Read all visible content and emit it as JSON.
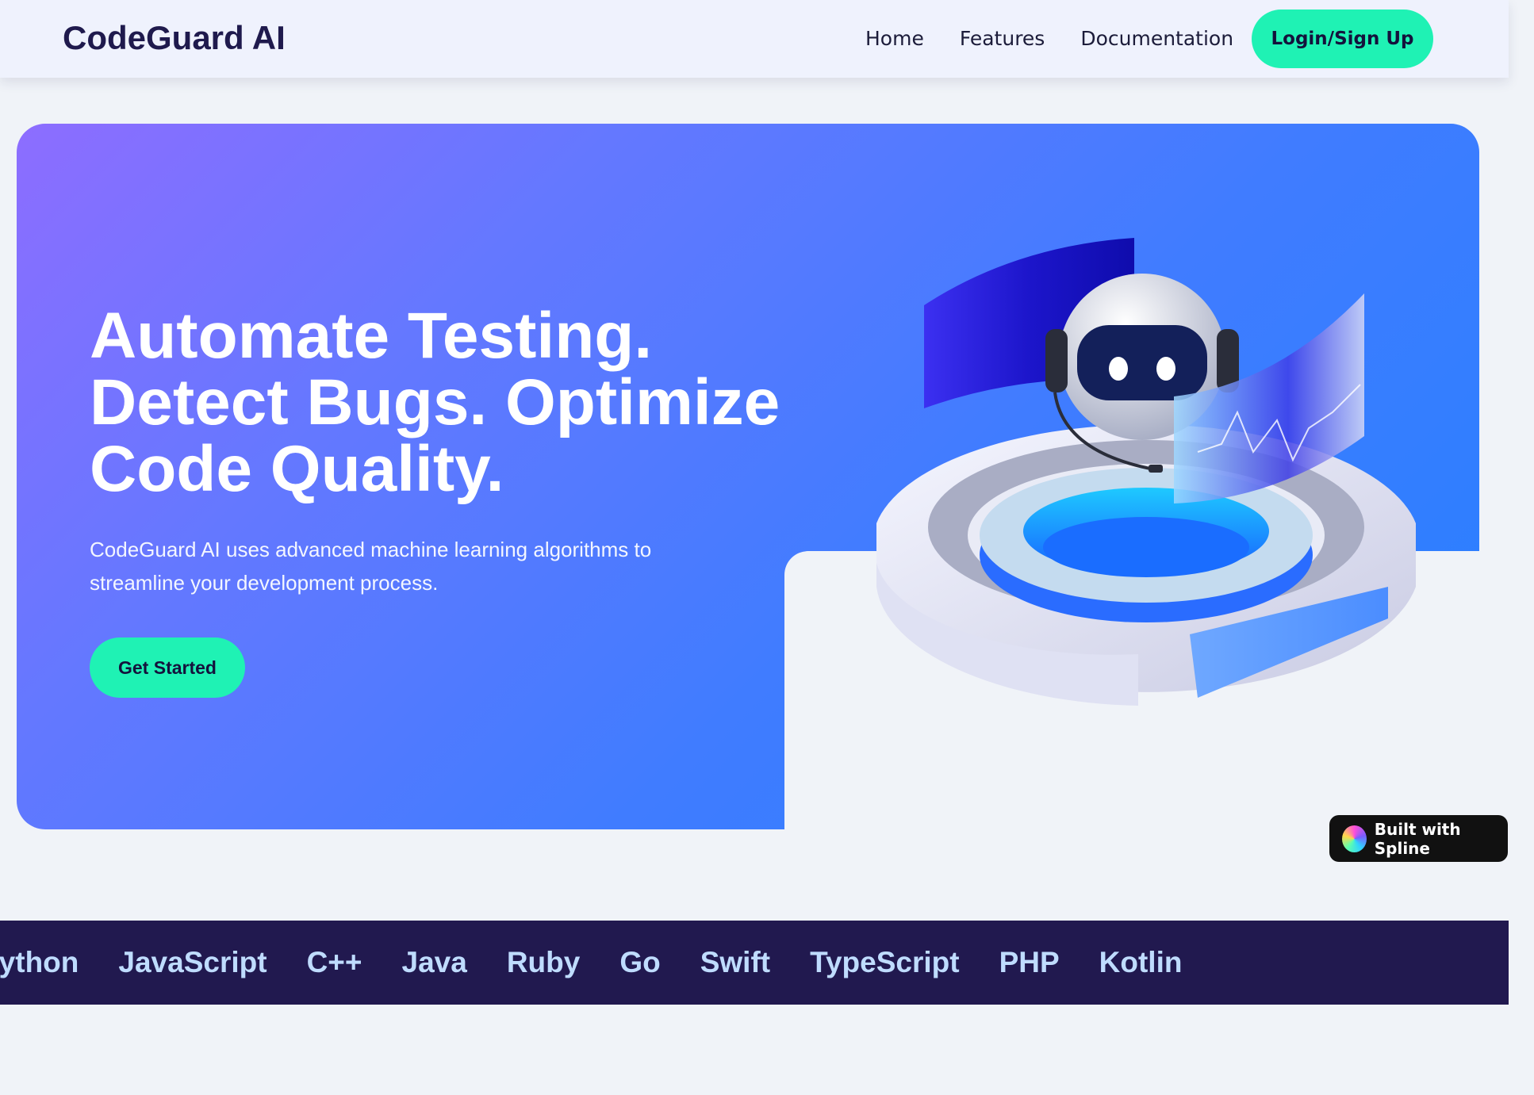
{
  "navbar": {
    "brand": "CodeGuard AI",
    "links": [
      "Home",
      "Features",
      "Documentation"
    ],
    "login_label": "Login/Sign Up"
  },
  "hero": {
    "title_lines": [
      "Automate Testing.",
      "Detect Bugs. Optimize",
      "Code Quality."
    ],
    "subtitle": "CodeGuard AI uses advanced machine learning algorithms to streamline your development process.",
    "cta_label": "Get Started",
    "gradient": [
      "#8d6dff",
      "#407cff",
      "#2680ff"
    ]
  },
  "badge": {
    "label": "Built with Spline"
  },
  "languages": [
    "Python",
    "JavaScript",
    "C++",
    "Java",
    "Ruby",
    "Go",
    "Swift",
    "TypeScript",
    "PHP",
    "Kotlin"
  ],
  "colors": {
    "accent": "#1ff2b4",
    "brand_text": "#1f1a4d",
    "band_bg": "#21194f",
    "band_text": "#bfdcff",
    "page_bg": "#f0f3f8"
  }
}
